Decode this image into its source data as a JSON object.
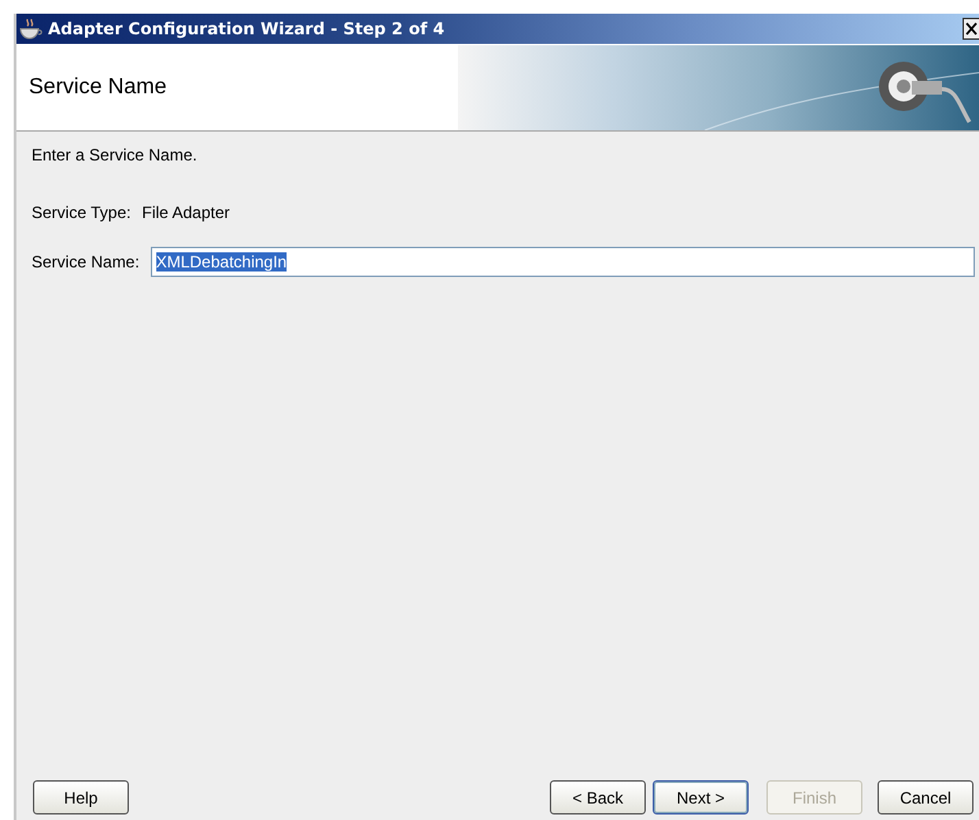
{
  "window": {
    "title": "Adapter Configuration Wizard - Step 2 of 4"
  },
  "header": {
    "title": "Service Name"
  },
  "content": {
    "instruction": "Enter a Service Name.",
    "service_type": {
      "label": "Service Type:",
      "value": "File Adapter"
    },
    "service_name": {
      "label": "Service Name:",
      "value": "XMLDebatchingIn",
      "selected": true
    }
  },
  "buttons": [
    {
      "label": "Help",
      "kind": "left",
      "disabled": false,
      "focused": false
    },
    {
      "label": "< Back",
      "kind": "right",
      "disabled": false,
      "focused": false
    },
    {
      "label": "Next >",
      "kind": "right",
      "disabled": false,
      "focused": true
    },
    {
      "label": "Finish",
      "kind": "right",
      "disabled": true,
      "focused": false
    },
    {
      "label": "Cancel",
      "kind": "right",
      "disabled": false,
      "focused": false
    }
  ]
}
